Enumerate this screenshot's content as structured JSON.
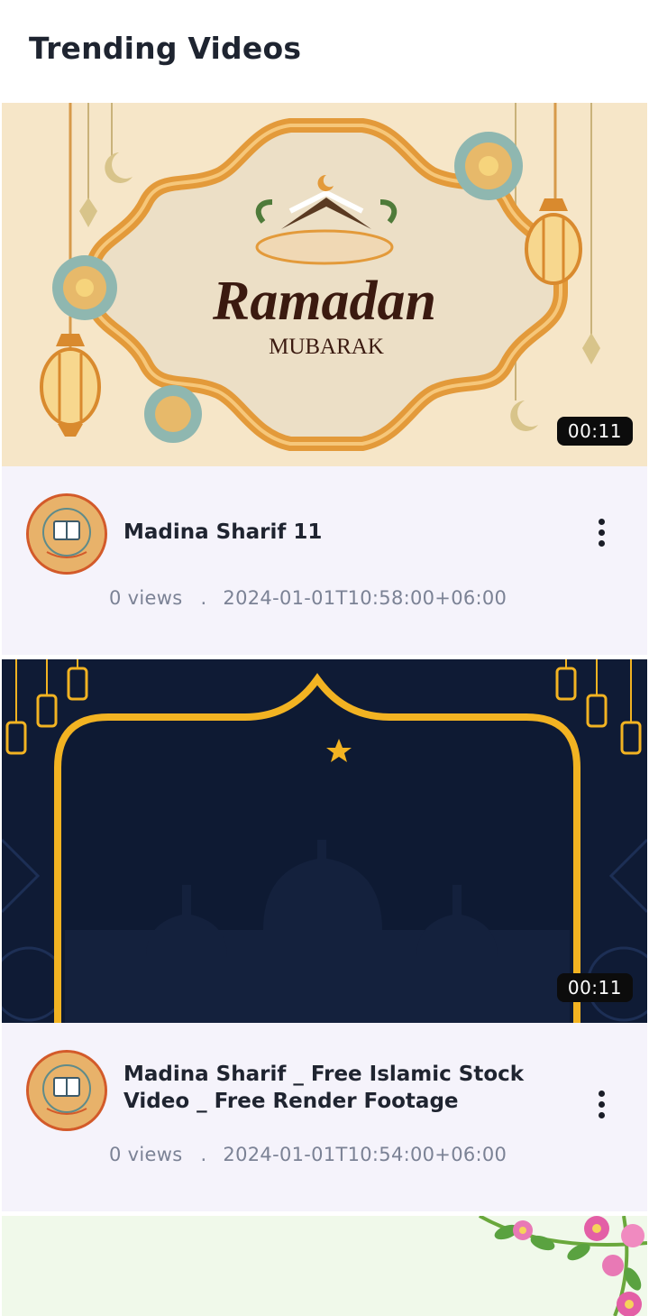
{
  "header": {
    "title": "Trending Videos"
  },
  "videos": [
    {
      "thumbnail": {
        "headline": "Ramadan",
        "subline": "MUBARAK"
      },
      "duration": "00:11",
      "title": "Madina Sharif 11",
      "views": "0 views",
      "separator": ".",
      "published": "2024-01-01T10:58:00+06:00"
    },
    {
      "duration": "00:11",
      "title": "Madina Sharif _ Free Islamic Stock Video _ Free Render Footage",
      "views": "0 views",
      "separator": ".",
      "published": "2024-01-01T10:54:00+06:00"
    }
  ],
  "icons": {
    "more": "more-vertical-icon",
    "avatar": "channel-avatar",
    "moon": "crescent-moon-icon"
  },
  "colors": {
    "card_bg": "#f5f3fb",
    "gold": "#f2b322",
    "navy": "#0e1a33",
    "cream": "#f6e6c8",
    "duration_bg": "#0c0c0c",
    "meta_text": "#7b8295"
  }
}
